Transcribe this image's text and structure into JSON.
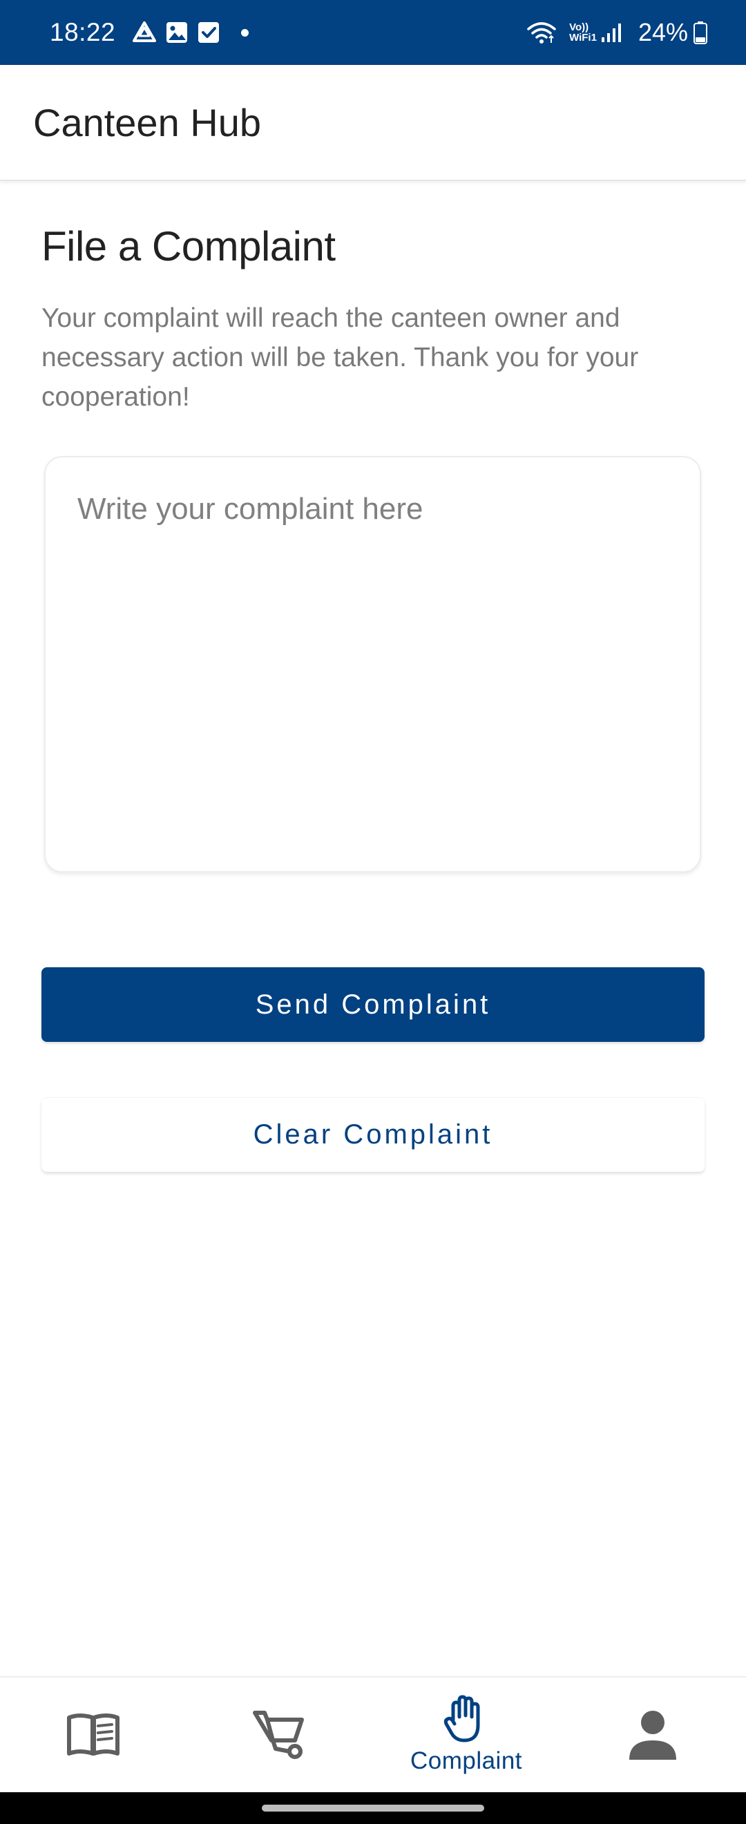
{
  "status_bar": {
    "time": "18:22",
    "network_label_top": "Vo))",
    "network_label_bottom": "WiFi1",
    "battery": "24%",
    "icons": [
      "drive-icon",
      "gallery-icon",
      "checkbox-icon",
      "notification-dot",
      "wifi-icon",
      "signal-icon",
      "battery-icon"
    ]
  },
  "app_bar": {
    "title": "Canteen Hub"
  },
  "main": {
    "title": "File a Complaint",
    "description": "Your complaint will reach the canteen owner and necessary action will be taken. Thank you for your cooperation!",
    "complaint_input": {
      "placeholder": "Write your complaint here",
      "value": ""
    },
    "send_button": "Send Complaint",
    "clear_button": "Clear Complaint"
  },
  "bottom_nav": {
    "items": [
      {
        "icon": "menu-book-icon",
        "label": "",
        "active": false
      },
      {
        "icon": "cart-icon",
        "label": "",
        "active": false
      },
      {
        "icon": "hand-icon",
        "label": "Complaint",
        "active": true
      },
      {
        "icon": "person-icon",
        "label": "",
        "active": false
      }
    ]
  },
  "colors": {
    "primary": "#024182",
    "inactive_icon": "#5f5f5f",
    "text_primary": "#222222",
    "text_secondary": "#7a7a7a"
  }
}
